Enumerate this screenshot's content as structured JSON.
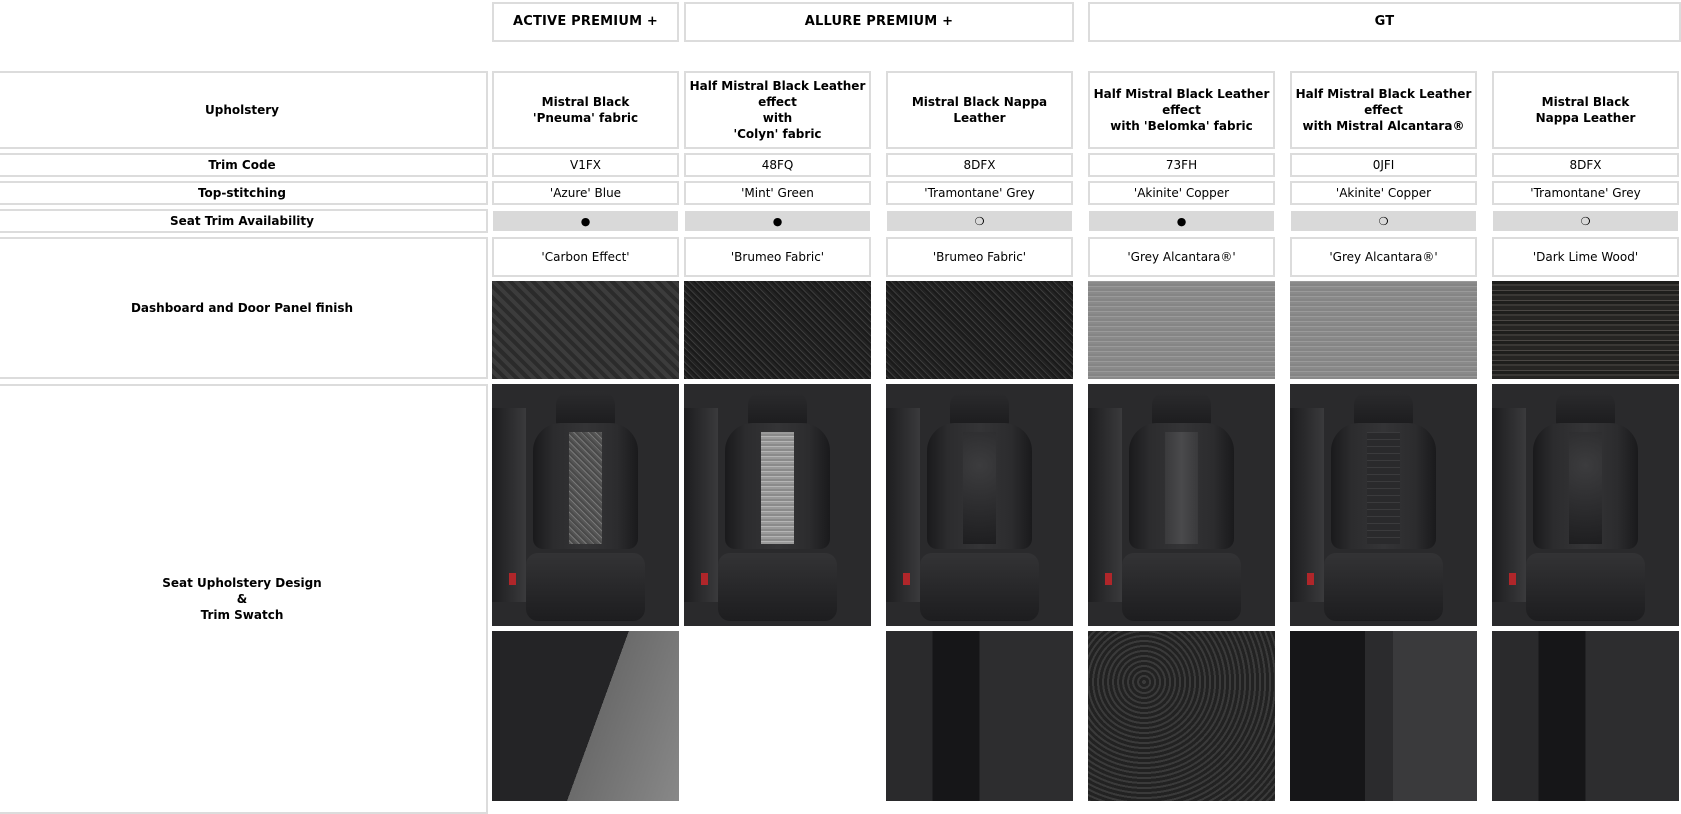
{
  "grades": [
    {
      "name": "ACTIVE PREMIUM +"
    },
    {
      "name": "ALLURE PREMIUM +"
    },
    {
      "name": "GT"
    }
  ],
  "row_labels": {
    "upholstery": "Upholstery",
    "trim_code": "Trim Code",
    "top_stitching": "Top-stitching",
    "availability": "Seat Trim Availability",
    "dashboard": "Dashboard and Door Panel finish",
    "seat_design": "Seat Upholstery Design\n&\nTrim Swatch"
  },
  "trims": [
    {
      "upholstery": "Mistral Black\n'Pneuma' fabric",
      "trim_code": "V1FX",
      "stitching": "'Azure' Blue",
      "availability": "●",
      "dashboard": "'Carbon Effect'",
      "dashboard_texture": "carbon"
    },
    {
      "upholstery": "Half Mistral Black Leather\neffect\nwith\n'Colyn' fabric",
      "trim_code": "48FQ",
      "stitching": "'Mint' Green",
      "availability": "●",
      "dashboard": "'Brumeo Fabric'",
      "dashboard_texture": "brumeo"
    },
    {
      "upholstery": "Mistral Black Nappa\nLeather",
      "trim_code": "8DFX",
      "stitching": "'Tramontane' Grey",
      "availability": "❍",
      "dashboard": "'Brumeo Fabric'",
      "dashboard_texture": "brumeo"
    },
    {
      "upholstery": "Half Mistral Black Leather\neffect\nwith 'Belomka' fabric",
      "trim_code": "73FH",
      "stitching": "'Akinite' Copper",
      "availability": "●",
      "dashboard": "'Grey Alcantara®'",
      "dashboard_texture": "alcantara"
    },
    {
      "upholstery": "Half Mistral Black Leather\neffect\nwith Mistral Alcantara®",
      "trim_code": "0JFI",
      "stitching": "'Akinite' Copper",
      "availability": "❍",
      "dashboard": "'Grey Alcantara®'",
      "dashboard_texture": "alcantara"
    },
    {
      "upholstery": "Mistral Black\nNappa Leather",
      "trim_code": "8DFX",
      "stitching": "'Tramontane' Grey",
      "availability": "❍",
      "dashboard": "'Dark Lime Wood'",
      "dashboard_texture": "wood"
    }
  ]
}
